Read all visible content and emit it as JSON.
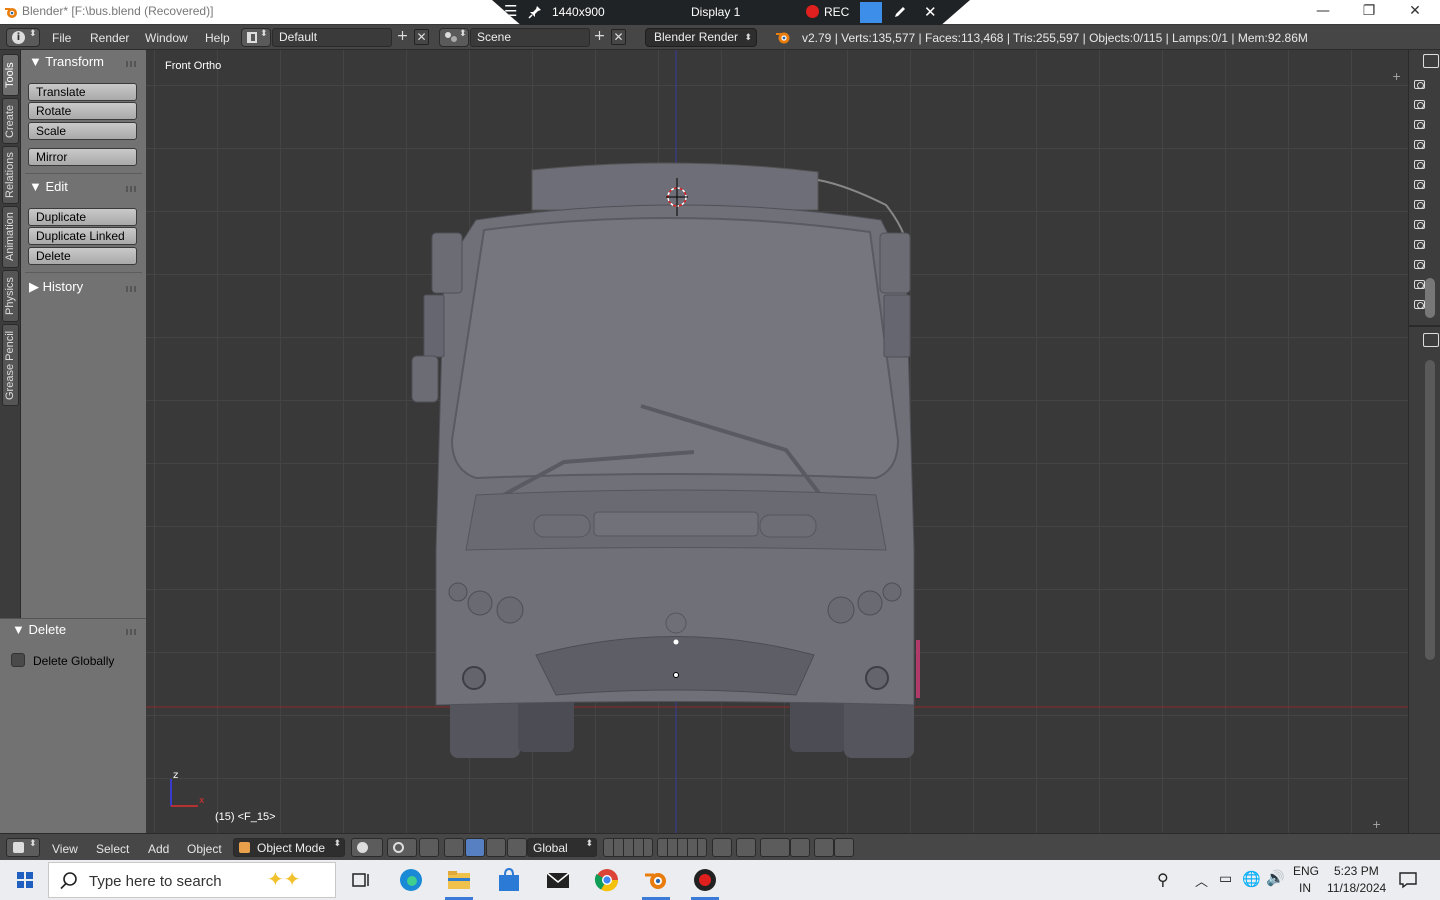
{
  "window": {
    "title": "Blender* [F:\\bus.blend (Recovered)]",
    "minimize": "—",
    "restore": "❐",
    "close": "✕"
  },
  "display_bar": {
    "resolution": "1440x900",
    "display": "Display 1",
    "rec": "REC"
  },
  "info_header": {
    "menus": [
      "File",
      "Render",
      "Window",
      "Help"
    ],
    "layout": "Default",
    "scene": "Scene",
    "engine": "Blender Render",
    "stats": "v2.79 | Verts:135,577 | Faces:113,468 | Tris:255,597 | Objects:0/115 | Lamps:0/1 | Mem:92.86M"
  },
  "tabs": [
    "Tools",
    "Create",
    "Relations",
    "Animation",
    "Physics",
    "Grease Pencil"
  ],
  "tool_panel": {
    "transform": {
      "title": "Transform",
      "buttons": [
        "Translate",
        "Rotate",
        "Scale"
      ],
      "mirror": "Mirror"
    },
    "edit": {
      "title": "Edit",
      "buttons": [
        "Duplicate",
        "Duplicate Linked",
        "Delete"
      ]
    },
    "history": {
      "title": "History"
    }
  },
  "operator_panel": {
    "title": "Delete",
    "option": "Delete Globally",
    "checked": false
  },
  "viewport": {
    "view_name": "Front Ortho",
    "frame": "(15) <F_15>",
    "axis_z": "z",
    "axis_x": "x"
  },
  "view3d_header": {
    "menus": [
      "View",
      "Select",
      "Add",
      "Object"
    ],
    "mode": "Object Mode",
    "orientation": "Global"
  },
  "taskbar": {
    "search_placeholder": "Type here to search",
    "language": "ENG",
    "region": "IN",
    "time": "5:23 PM",
    "date": "11/18/2024"
  },
  "colors": {
    "accent_orange": "#e87d0d",
    "rec_red": "#e01f1f",
    "viewport_bg": "#393939",
    "panel_bg": "#727272"
  }
}
